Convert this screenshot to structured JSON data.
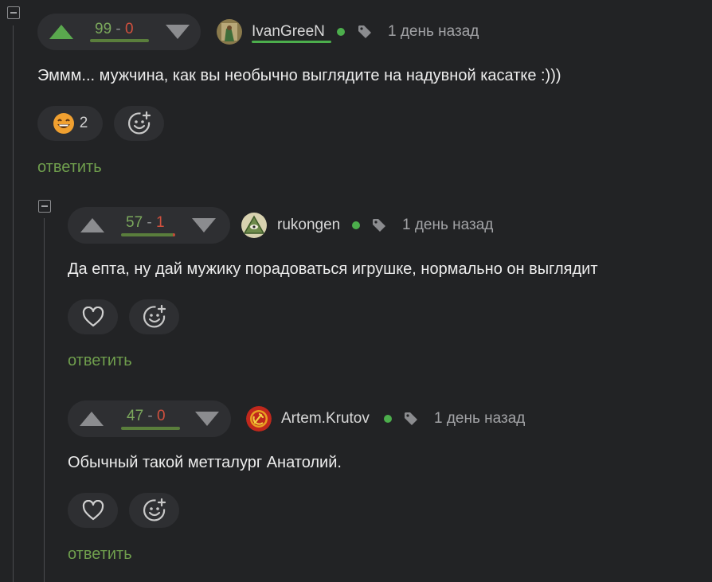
{
  "colors": {
    "accent_green": "#6f9e4d",
    "negative_red": "#d0503e",
    "background": "#222325",
    "pill": "#2e2f32"
  },
  "comments": [
    {
      "score_plus": "99",
      "score_sep": " - ",
      "score_minus": "0",
      "author": "IvanGreeN",
      "time": "1 день назад",
      "text": "Эммм... мужчина, как вы необычно выглядите на надувной касатке :)))",
      "reaction_icon": "grinning-face-emoji",
      "reaction_count": "2",
      "reply": "ответить"
    },
    {
      "score_plus": "57",
      "score_sep": " - ",
      "score_minus": "1",
      "author": "rukongen",
      "time": "1 день назад",
      "text": "Да епта, ну дай мужику порадоваться игрушке, нормально он выглядит",
      "reply": "ответить"
    },
    {
      "score_plus": "47",
      "score_sep": " - ",
      "score_minus": "0",
      "author": "Artem.Krutov",
      "time": "1 день назад",
      "text": "Обычный такой метталург Анатолий.",
      "reply": "ответить"
    }
  ]
}
